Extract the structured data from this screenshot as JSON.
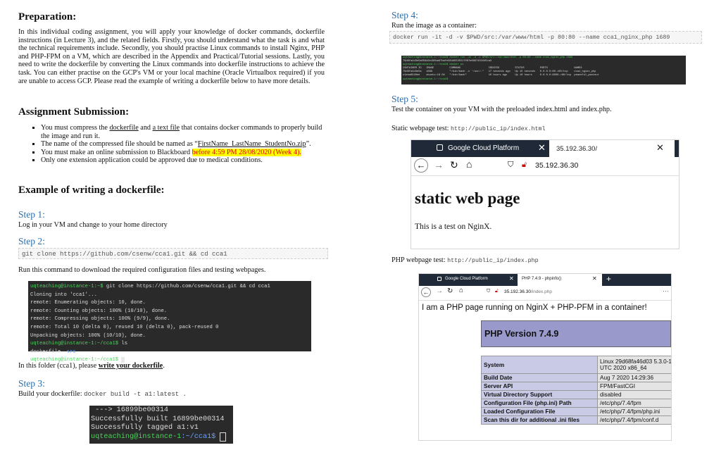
{
  "left": {
    "prep_heading": "Preparation:",
    "prep_text": "In this individual coding assignment, you will apply your knowledge of docker commands, dockerfile instructions (in Lecture 3), and the related fields. Firstly, you should understand what the task is and what the technical requirements include. Secondly, you should practise Linux commands to install Nginx, PHP and PHP-FPM on a VM, which are described in the Appendix and Practical/Tutorial sessions. Lastly, you need to write the dockerfile by converting the Linux commands into dockerfile instructions to achieve the task. You can either practise on the GCP's VM or your local machine (Oracle Virtualbox required) if you are unable to access GCP. Please read the example of writing a dockerfile below to have more details.",
    "sub_heading": "Assignment Submission:",
    "bullet1_a": "You must compress the ",
    "bullet1_u1": "dockerfile",
    "bullet1_b": " and ",
    "bullet1_u2": "a text file",
    "bullet1_c": " that contains docker commands to properly build the image and run it.",
    "bullet2_a": "The name of the compressed file should be named as “",
    "bullet2_u": "FirstName_LastName_StudentNo.zip",
    "bullet2_b": "”.",
    "bullet3_a": "You must make an online submission to Blackboard ",
    "bullet3_hl": "before 4:59 PM 28/08/2020 (Week 4).",
    "bullet4": "Only one extension application could be approved due to medical conditions.",
    "example_heading": "Example of writing a dockerfile:",
    "step1": "Step 1:",
    "step1_text": "Log in your VM and change to your home directory",
    "step2": "Step 2:",
    "step2_code": "git clone https://github.com/csenw/cca1.git && cd cca1",
    "step2_text": "Run this command to download the required configuration files and testing webpages.",
    "term1": {
      "prompt": "uqteaching@instance-1:~$",
      "cmd": " git clone https://github.com/csenw/cca1.git && cd cca1",
      "lines": [
        "Cloning into 'cca1'...",
        "remote: Enumerating objects: 10, done.",
        "remote: Counting objects: 100% (10/10), done.",
        "remote: Compressing objects: 100% (9/9), done.",
        "remote: Total 10 (delta 0), reused 10 (delta 0), pack-reused 0",
        "Unpacking objects: 100% (10/10), done."
      ],
      "prompt2": "uqteaching@instance-1:~/cca1$",
      "cmd2": " ls",
      "ls_a": "dockerfile",
      "ls_b": "src",
      "prompt3": "uqteaching@instance-1:~/cca1$"
    },
    "folder_text_a": "In this folder (cca1), please ",
    "folder_text_b": "write your dockerfile",
    "folder_text_c": ".",
    "step3": "Step 3:",
    "step3_label": "Build your dockerfile: ",
    "step3_code": "docker build -t a1:latest .",
    "term2": {
      "l1": " ---> 16899be00314",
      "l2": "Successfully built 16899be00314",
      "l3": "Successfully tagged a1:v1",
      "prompt": "uqteaching@instance-1",
      "path": ":~/cca1$"
    }
  },
  "right": {
    "step4": "Step 4:",
    "step4_text": "Run the image as a container:",
    "step4_code": "docker run -it -d -v $PWD/src:/var/www/html -p 80:80 --name cca1_nginx_php 1689",
    "term3": {
      "l1": "uqteaching@instance-1:~/cca1$ docker run -it -d -v $PWD/src:/var/www/html -p 80:80 --name cca1_nginx_php 1689",
      "l2": "79d8fa4d3e5a059d2e190ba67bafe384d5535517087e8897431645ca3",
      "l3": "uqteaching@instance-1:~/cca1$ docker ps",
      "l4": "CONTAINER ID   IMAGE          COMMAND                  CREATED          STATUS          PORTS                 NAMES",
      "l5": "79d8fa4d3e5a   1689           \"/bin/bash -c '/usr/…\"   17 seconds ago   Up 15 seconds   0.0.0.0:80->80/tcp    cca1_nginx_php",
      "l6": "c1eea6540ee    ubuntu:18.04   \"/bin/bash\"              10 hours ago     Up 10 hours     0.0.0.0:9000->80/tcp  peaceful_pasteur",
      "l7": "uqteaching@instance-1:~/cca1$"
    },
    "step5": "Step 5:",
    "step5_text": "Test the container on your VM with the preloaded index.html and index.php.",
    "static_label": "Static webpage test: ",
    "static_url": "http://public_ip/index.html",
    "browser1": {
      "tab1": "Google Cloud Platform",
      "tab2": "35.192.36.30/",
      "address": "35.192.36.30",
      "heading": "static web page",
      "body": "This is a test on NginX."
    },
    "php_label": "PHP webpage test: ",
    "php_url": "http://public_ip/index.php",
    "browser2": {
      "tab1": "Google Cloud Platform",
      "tab2": "PHP 7.4.9 - phpinfo()",
      "address_a": "35.192.36.30",
      "address_b": "/index.php",
      "intro": "I am a PHP page running on NginX + PHP-PFM in a container!",
      "version": "PHP Version 7.4.9",
      "rows": [
        {
          "k": "System",
          "v": "Linux 29d68fa46d03 5.3.0-1 UTC 2020 x86_64"
        },
        {
          "k": "Build Date",
          "v": "Aug 7 2020 14:29:36"
        },
        {
          "k": "Server API",
          "v": "FPM/FastCGI"
        },
        {
          "k": "Virtual Directory Support",
          "v": "disabled"
        },
        {
          "k": "Configuration File (php.ini) Path",
          "v": "/etc/php/7.4/fpm"
        },
        {
          "k": "Loaded Configuration File",
          "v": "/etc/php/7.4/fpm/php.ini"
        },
        {
          "k": "Scan this dir for additional .ini files",
          "v": "/etc/php/7.4/fpm/conf.d"
        }
      ]
    }
  }
}
